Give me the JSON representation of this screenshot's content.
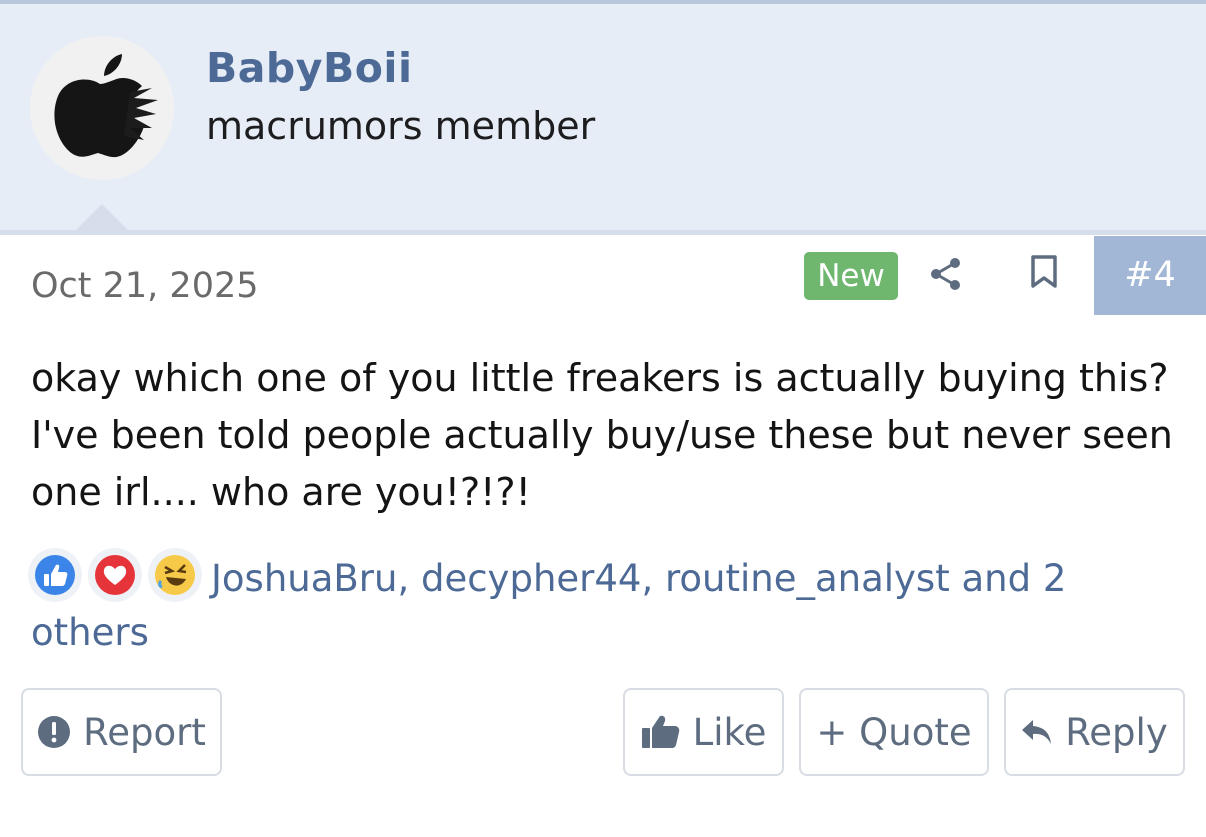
{
  "user": {
    "username": "BabyBoii",
    "title": "macrumors member",
    "avatar_icon": "apple-logo-icon"
  },
  "post": {
    "date": "Oct 21, 2025",
    "badge": "New",
    "number": "#4",
    "body": "okay which one of you little freakers is actually buying this? I've been told people actually buy/use these but never seen one irl.... who are you!?!?!",
    "share_icon": "share-icon",
    "bookmark_icon": "bookmark-icon"
  },
  "reactions": {
    "icons": [
      "like-reaction-icon",
      "love-reaction-icon",
      "haha-reaction-icon"
    ],
    "text": "JoshuaBru, decypher44, routine_analyst and 2 others"
  },
  "actions": {
    "report": "Report",
    "like": "Like",
    "quote": "+ Quote",
    "reply": "Reply"
  },
  "colors": {
    "accent": "#4d6a96",
    "header_bg": "#e7edf6",
    "badge_green": "#6fb66f",
    "post_number_bg": "#a2b6d6"
  }
}
